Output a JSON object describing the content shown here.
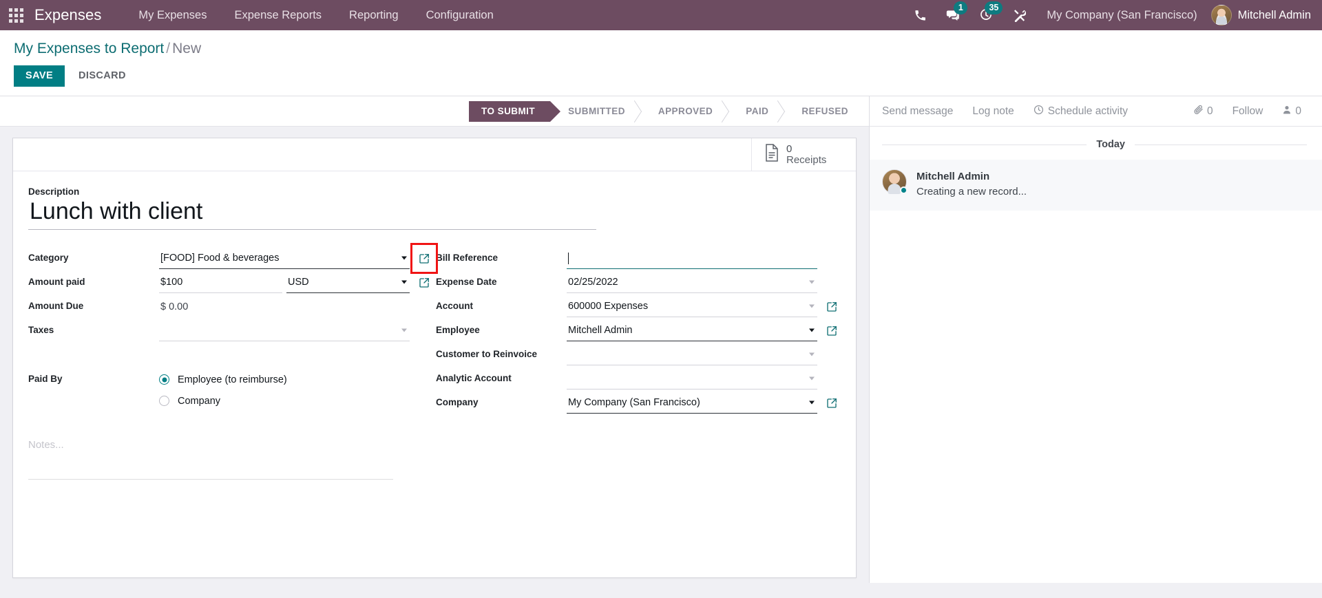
{
  "navbar": {
    "apps_icon": "apps-grid-icon",
    "brand": "Expenses",
    "menu": [
      {
        "label": "My Expenses"
      },
      {
        "label": "Expense Reports"
      },
      {
        "label": "Reporting"
      },
      {
        "label": "Configuration"
      }
    ],
    "icons": {
      "phone": "phone-icon",
      "messages": "chat-bubble-icon",
      "messages_count": "1",
      "activities": "clock-activity-icon",
      "activities_count": "35",
      "debug": "wrench-tools-icon"
    },
    "company": "My Company (San Francisco)",
    "user": "Mitchell Admin"
  },
  "control_panel": {
    "breadcrumb_root": "My Expenses to Report",
    "breadcrumb_sep": "/",
    "breadcrumb_current": "New",
    "save_label": "SAVE",
    "discard_label": "DISCARD"
  },
  "statusbar": {
    "stages": [
      {
        "label": "TO SUBMIT",
        "active": true
      },
      {
        "label": "SUBMITTED",
        "active": false
      },
      {
        "label": "APPROVED",
        "active": false
      },
      {
        "label": "PAID",
        "active": false
      },
      {
        "label": "REFUSED",
        "active": false
      }
    ]
  },
  "stat_buttons": [
    {
      "value": "0",
      "label": "Receipts",
      "icon": "document-icon"
    }
  ],
  "form": {
    "description_label": "Description",
    "description_value": "Lunch with client",
    "left_fields": {
      "category_label": "Category",
      "category_value": "[FOOD] Food & beverages",
      "amount_paid_label": "Amount paid",
      "amount_paid_value": "$100",
      "currency_value": "USD",
      "amount_due_label": "Amount Due",
      "amount_due_value": "$ 0.00",
      "taxes_label": "Taxes",
      "taxes_value": ""
    },
    "right_fields": {
      "bill_reference_label": "Bill Reference",
      "bill_reference_value": "",
      "expense_date_label": "Expense Date",
      "expense_date_value": "02/25/2022",
      "account_label": "Account",
      "account_value": "600000 Expenses",
      "employee_label": "Employee",
      "employee_value": "Mitchell Admin",
      "customer_label": "Customer to Reinvoice",
      "customer_value": "",
      "analytic_label": "Analytic Account",
      "analytic_value": "",
      "company_label": "Company",
      "company_value": "My Company (San Francisco)"
    },
    "paid_by_label": "Paid By",
    "paid_by_options": [
      {
        "label": "Employee (to reimburse)",
        "selected": true
      },
      {
        "label": "Company",
        "selected": false
      }
    ],
    "notes_placeholder": "Notes..."
  },
  "chatter": {
    "send_message": "Send message",
    "log_note": "Log note",
    "schedule_activity": "Schedule activity",
    "attachment_count": "0",
    "follow_label": "Follow",
    "follower_count": "0",
    "day_separator": "Today",
    "messages": [
      {
        "author": "Mitchell Admin",
        "body": "Creating a new record..."
      }
    ]
  },
  "colors": {
    "navbar": "#6d4c61",
    "accent_teal": "#017e84",
    "breadcrumb_link": "#0d6d72",
    "highlight_red": "#f01414",
    "page_bg": "#f0f0f4"
  }
}
